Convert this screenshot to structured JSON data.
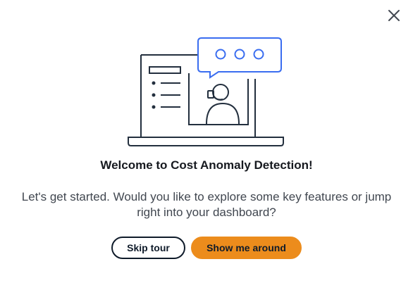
{
  "modal": {
    "close_icon": "close-icon",
    "illustration_icon": "support-agent-laptop-illustration",
    "title": "Welcome to Cost Anomaly Detection!",
    "body": "Let's get started. Would you like to explore some key features or jump right into your dashboard?",
    "buttons": {
      "skip_label": "Skip tour",
      "show_label": "Show me around"
    }
  },
  "colors": {
    "text": "#16191f",
    "body_text": "#414750",
    "primary_button": "#ec8c1c",
    "secondary_border": "#0f1b2a",
    "illustration_stroke": "#232f3e",
    "speech_bubble": "#3a6df0"
  }
}
